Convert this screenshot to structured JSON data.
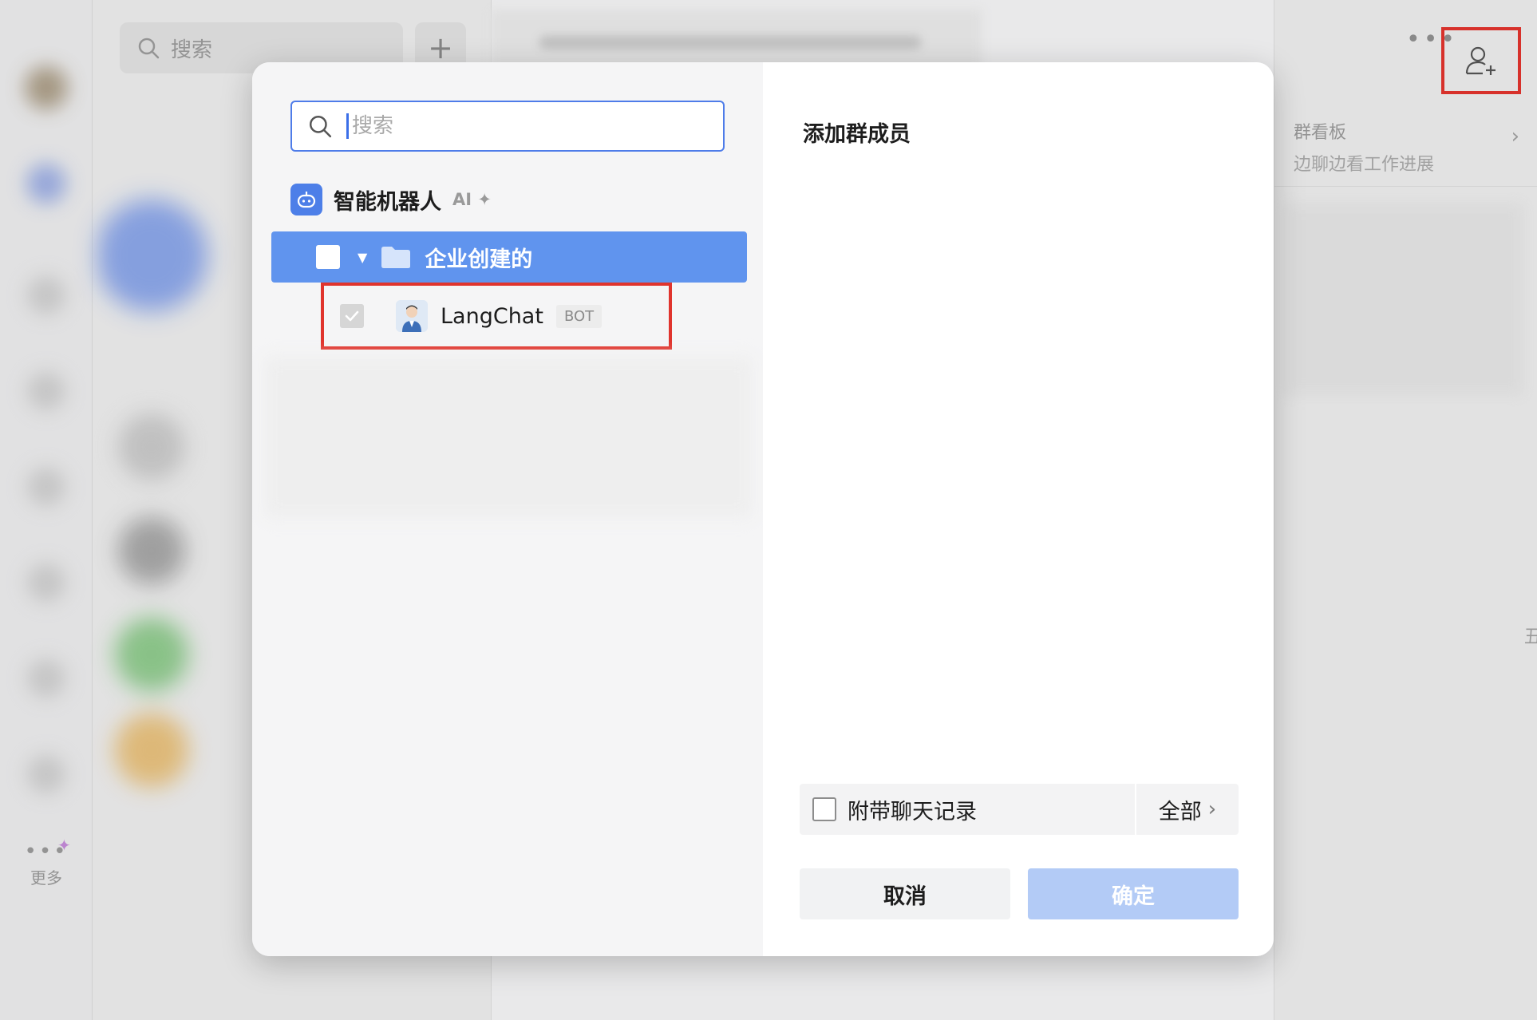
{
  "background": {
    "chat_search_placeholder": "搜索",
    "more_label": "更多",
    "board": {
      "title": "群看板",
      "subtitle": "边聊边看工作进展"
    }
  },
  "dialog": {
    "search": {
      "placeholder": "搜索",
      "value": ""
    },
    "category": {
      "label": "智能机器人",
      "badge": "AI"
    },
    "group": {
      "label": "企业创建的",
      "checked": false,
      "expanded": true
    },
    "bot": {
      "name": "LangChat",
      "tag": "BOT",
      "checked": true,
      "disabled": true
    },
    "title": "添加群成员",
    "history": {
      "label": "附带聊天记录",
      "range": "全部",
      "checked": false
    },
    "buttons": {
      "cancel": "取消",
      "confirm": "确定"
    }
  },
  "colors": {
    "accent": "#4e7ce9",
    "selected_row": "#6094ee",
    "confirm_disabled": "#b3cbf6",
    "highlight_box": "#e0342d"
  }
}
